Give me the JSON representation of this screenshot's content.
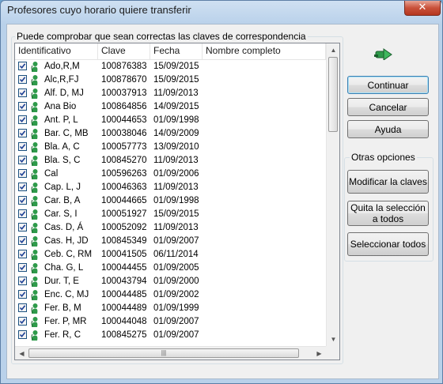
{
  "window": {
    "title": "Profesores cuyo horario quiere transferir",
    "close_glyph": "✕"
  },
  "group": {
    "label": "Puede comprobar que sean correctas las claves de correspondencia"
  },
  "columns": [
    "Identificativo",
    "Clave",
    "Fecha",
    "Nombre completo"
  ],
  "rows": [
    {
      "id": "Ado,R,M",
      "clave": "100876383",
      "fecha": "15/09/2015",
      "nombre": ""
    },
    {
      "id": "Alc,R,FJ",
      "clave": "100878670",
      "fecha": "15/09/2015",
      "nombre": ""
    },
    {
      "id": "Alf. D, MJ",
      "clave": "100037913",
      "fecha": "11/09/2013",
      "nombre": ""
    },
    {
      "id": "Ana Bio",
      "clave": "100864856",
      "fecha": "14/09/2015",
      "nombre": ""
    },
    {
      "id": "Ant. P, L",
      "clave": "100044653",
      "fecha": "01/09/1998",
      "nombre": ""
    },
    {
      "id": "Bar. C, MB",
      "clave": "100038046",
      "fecha": "14/09/2009",
      "nombre": ""
    },
    {
      "id": "Bla. A, C",
      "clave": "100057773",
      "fecha": "13/09/2010",
      "nombre": ""
    },
    {
      "id": "Bla. S, C",
      "clave": "100845270",
      "fecha": "11/09/2013",
      "nombre": ""
    },
    {
      "id": "Cal",
      "clave": "100596263",
      "fecha": "01/09/2006",
      "nombre": ""
    },
    {
      "id": "Cap. L, J",
      "clave": "100046363",
      "fecha": "11/09/2013",
      "nombre": ""
    },
    {
      "id": "Car. B, A",
      "clave": "100044665",
      "fecha": "01/09/1998",
      "nombre": ""
    },
    {
      "id": "Car. S, I",
      "clave": "100051927",
      "fecha": "15/09/2015",
      "nombre": ""
    },
    {
      "id": "Cas. D, Á",
      "clave": "100052092",
      "fecha": "11/09/2013",
      "nombre": ""
    },
    {
      "id": "Cas. H, JD",
      "clave": "100845349",
      "fecha": "01/09/2007",
      "nombre": ""
    },
    {
      "id": "Ceb. C, RM",
      "clave": "100041505",
      "fecha": "06/11/2014",
      "nombre": ""
    },
    {
      "id": "Cha. G, L",
      "clave": "100044455",
      "fecha": "01/09/2005",
      "nombre": ""
    },
    {
      "id": "Dur. T, E",
      "clave": "100043794",
      "fecha": "01/09/2000",
      "nombre": ""
    },
    {
      "id": "Enc. C, MJ",
      "clave": "100044485",
      "fecha": "01/09/2002",
      "nombre": ""
    },
    {
      "id": "Fer. B, M",
      "clave": "100044489",
      "fecha": "01/09/1999",
      "nombre": ""
    },
    {
      "id": "Fer. P, MR",
      "clave": "100044048",
      "fecha": "01/09/2007",
      "nombre": ""
    },
    {
      "id": "Fer. R, C",
      "clave": "100845275",
      "fecha": "01/09/2007",
      "nombre": ""
    }
  ],
  "buttons": {
    "continuar": "Continuar",
    "cancelar": "Cancelar",
    "ayuda": "Ayuda",
    "modificar": "Modificar la claves",
    "quitar": "Quita la selección a todos",
    "seleccionar": "Seleccionar todos"
  },
  "options_label": "Otras opciones",
  "colors": {
    "accent": "#3c7fb1",
    "titlebar": "#b9d1ea",
    "close": "#c9513a",
    "icon": "#2e9a4a"
  }
}
